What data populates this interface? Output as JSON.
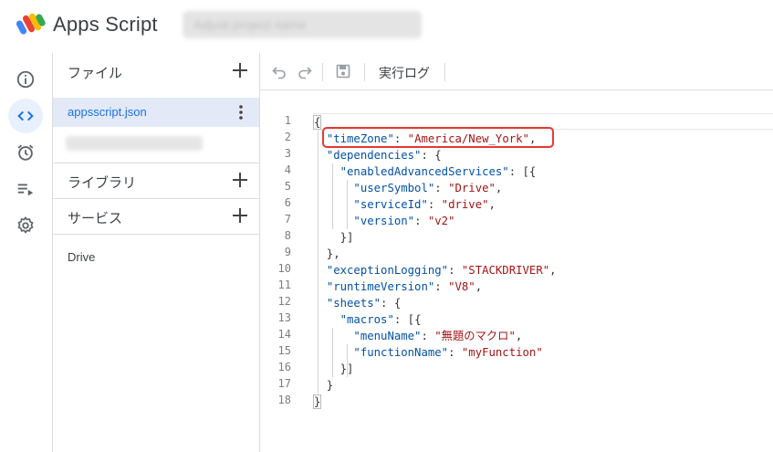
{
  "header": {
    "app_title": "Apps Script",
    "project_name": "Adjust project name"
  },
  "rail": {
    "items": [
      {
        "name": "overview",
        "icon": "info-icon"
      },
      {
        "name": "editor",
        "icon": "code-icon",
        "active": true
      },
      {
        "name": "triggers",
        "icon": "alarm-icon"
      },
      {
        "name": "executions",
        "icon": "executions-list-icon"
      },
      {
        "name": "settings",
        "icon": "gear-icon"
      }
    ]
  },
  "files_panel": {
    "files_label": "ファイル",
    "files": [
      {
        "name": "appsscript.json",
        "selected": true
      },
      {
        "name": "Adjust script file",
        "blurred": true
      }
    ],
    "libraries_label": "ライブラリ",
    "services_label": "サービス",
    "services": [
      "Drive"
    ]
  },
  "toolbar": {
    "undo": "undo-icon",
    "redo": "redo-icon",
    "save": "save-icon",
    "exec_log_label": "実行ログ"
  },
  "editor": {
    "line_numbers": [
      "1",
      "2",
      "3",
      "4",
      "5",
      "6",
      "7",
      "8",
      "9",
      "10",
      "11",
      "12",
      "13",
      "14",
      "15",
      "16",
      "17",
      "18"
    ],
    "colors": {
      "key": "#0451a5",
      "string": "#a31515",
      "punct": "#333333",
      "highlight": "#e53935"
    }
  }
}
